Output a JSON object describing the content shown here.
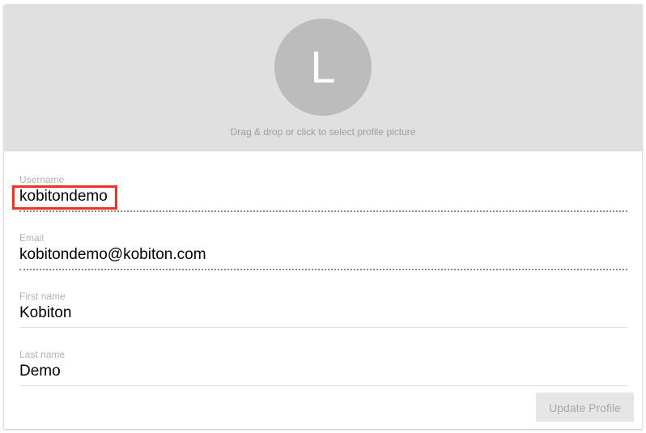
{
  "profile_picture": {
    "initial": "L",
    "hint": "Drag & drop or click to select profile picture"
  },
  "fields": {
    "username": {
      "label": "Username",
      "value": "kobitondemo"
    },
    "email": {
      "label": "Email",
      "value": "kobitondemo@kobiton.com"
    },
    "first_name": {
      "label": "First name",
      "value": "Kobiton"
    },
    "last_name": {
      "label": "Last name",
      "value": "Demo"
    }
  },
  "actions": {
    "update_label": "Update Profile"
  },
  "colors": {
    "header_bg": "#e0e0e0",
    "avatar_bg": "#bcbcbc",
    "highlight_border": "#e8332a",
    "button_bg": "#e6e6e6"
  }
}
